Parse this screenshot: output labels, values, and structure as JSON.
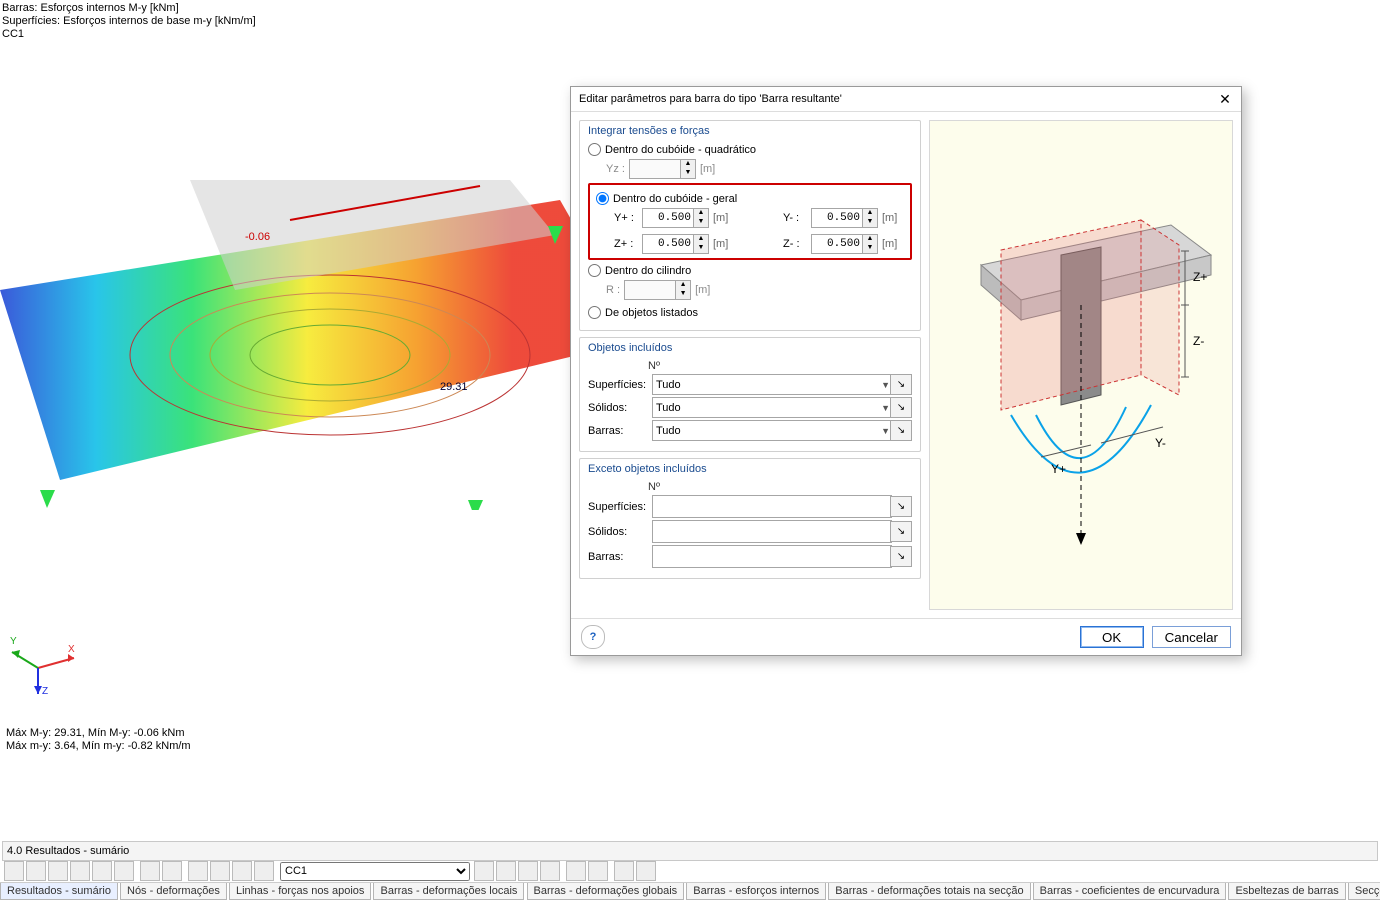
{
  "viewport": {
    "top_lines": [
      "Barras: Esforços internos M-y [kNm]",
      "Superfícies: Esforços internos de base m-y [kNm/m]",
      "CC1"
    ],
    "readouts": {
      "minus006": "-0.06",
      "plus2931": "29.31"
    },
    "bottom_lines": [
      "Máx M-y: 29.31, Mín M-y: -0.06 kNm",
      "Máx m-y: 3.64, Mín m-y: -0.82 kNm/m"
    ],
    "axes": {
      "x": "X",
      "y": "Y",
      "z": "Z"
    }
  },
  "status_text": "4.0 Resultados - sumário",
  "toolbar": {
    "combo": "CC1"
  },
  "tabs": [
    "Resultados - sumário",
    "Nós - deformações",
    "Linhas - forças nos apoios",
    "Barras - deformações locais",
    "Barras - deformações globais",
    "Barras - esforços internos",
    "Barras - deformações totais na secção",
    "Barras - coeficientes de encurvadura",
    "Esbeltezas de barras",
    "Secções - esforços internos"
  ],
  "dialog": {
    "title": "Editar parâmetros para barra do tipo 'Barra resultante'",
    "group_integrate": "Integrar tensões e forças",
    "opt_quad": "Dentro do cubóide - quadrático",
    "yz_label": "Yz :",
    "opt_geral": "Dentro do cubóide - geral",
    "yplus": "Y+ :",
    "yminus": "Y- :",
    "zplus": "Z+ :",
    "zminus": "Z- :",
    "val_yplus": "0.500",
    "val_yminus": "0.500",
    "val_zplus": "0.500",
    "val_zminus": "0.500",
    "unit": "[m]",
    "opt_cyl": "Dentro do cilindro",
    "r_label": "R :",
    "opt_listed": "De objetos listados",
    "group_incl": "Objetos incluídos",
    "no_label": "Nº",
    "superficies": "Superfícies:",
    "solidos": "Sólidos:",
    "barras": "Barras:",
    "tudo": "Tudo",
    "group_excl": "Exceto objetos incluídos",
    "ok": "OK",
    "cancel": "Cancelar",
    "diagram_labels": {
      "zplus": "Z+",
      "zminus": "Z-",
      "yplus": "Y+",
      "yminus": "Y-"
    }
  }
}
